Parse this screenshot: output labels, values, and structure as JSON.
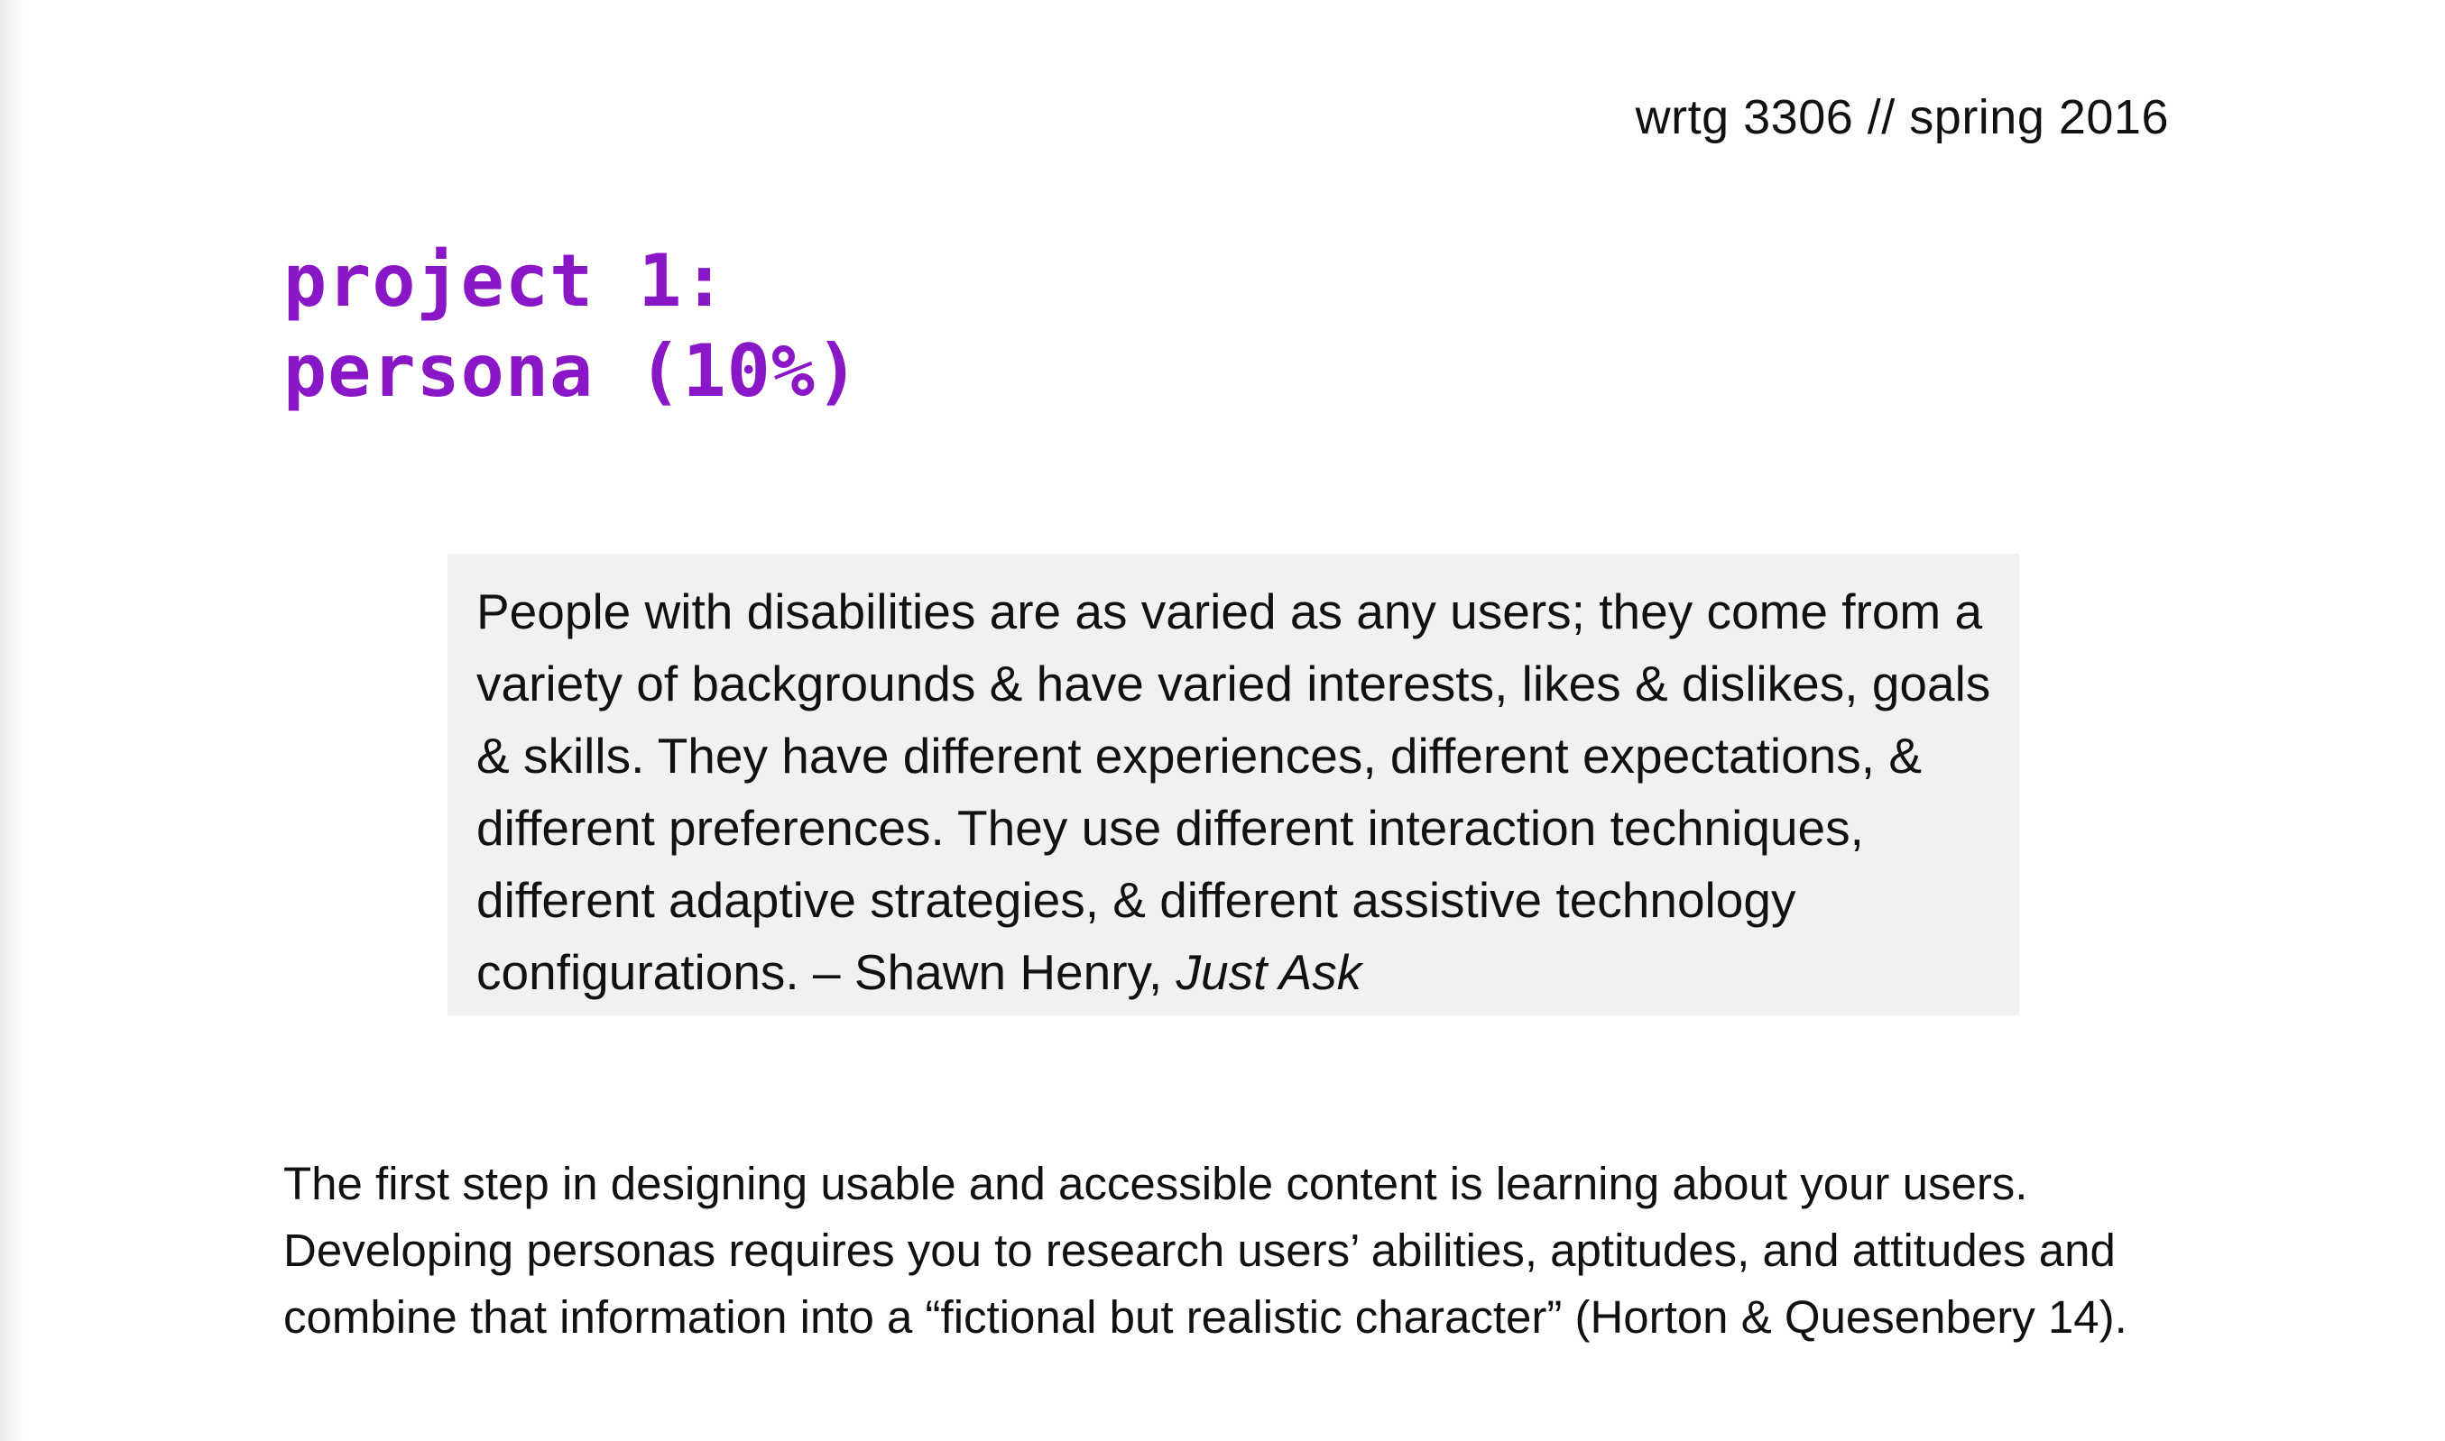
{
  "header": {
    "course": "wrtg 3306 // spring 2016"
  },
  "title": {
    "line1": "project 1:",
    "line2": "persona (10%)"
  },
  "quote": {
    "text": "People with disabilities are as varied as any users; they come from a variety of backgrounds & have varied interests, likes & dislikes, goals & skills. They have different experiences, different expectations, & different preferences. They use different interaction techniques, different adaptive strategies, & different assistive technology configurations. – Shawn Henry, ",
    "source": "Just Ask"
  },
  "body": {
    "paragraph": "The first step in designing usable and accessible content is learning about your users. Developing personas requires you to research users’ abilities, aptitudes, and attitudes and combine that information into a “fictional but realistic character” (Horton & Quesenbery 14)."
  },
  "colors": {
    "title": "#8a17c7",
    "quote_background": "#f1f1f1",
    "text": "#111111"
  }
}
